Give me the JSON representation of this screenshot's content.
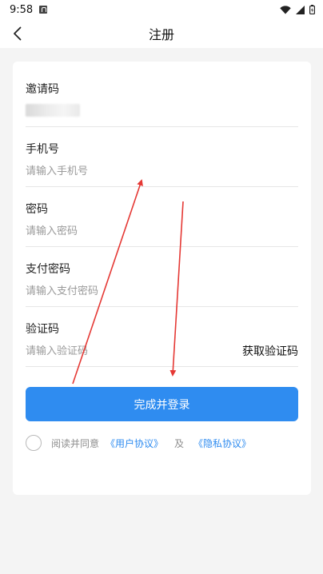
{
  "status_bar": {
    "time": "9:58",
    "icons": [
      "notification-a-icon",
      "wifi-icon",
      "signal-icon",
      "battery-icon"
    ]
  },
  "header": {
    "title": "注册",
    "back_icon": "chevron-left-icon"
  },
  "form": {
    "invite_code": {
      "label": "邀请码"
    },
    "phone": {
      "label": "手机号",
      "placeholder": "请输入手机号"
    },
    "password": {
      "label": "密码",
      "placeholder": "请输入密码"
    },
    "pay_password": {
      "label": "支付密码",
      "placeholder": "请输入支付密码"
    },
    "verify_code": {
      "label": "验证码",
      "placeholder": "请输入验证码",
      "get_code_label": "获取验证码"
    }
  },
  "submit": {
    "label": "完成并登录"
  },
  "agreement": {
    "prefix": "阅读并同意",
    "user_agreement": "《用户协议》",
    "and": "及",
    "privacy_policy": "《隐私协议》",
    "checked": false
  },
  "colors": {
    "accent": "#2f8cf0",
    "annotation_arrow": "#e53935",
    "background": "#f4f4f4"
  }
}
